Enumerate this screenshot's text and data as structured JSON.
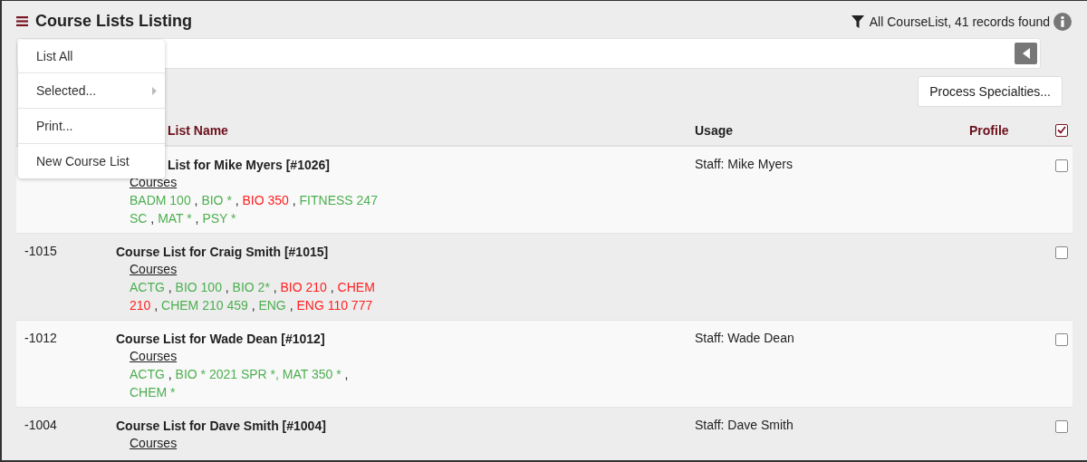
{
  "header": {
    "title": "Course Lists Listing",
    "status": "All CourseList, 41 records found"
  },
  "menu": {
    "items": [
      {
        "label": "List All",
        "submenu": false
      },
      {
        "label": "Selected...",
        "submenu": true
      },
      {
        "label": "Print...",
        "submenu": false
      },
      {
        "label": "New Course List",
        "submenu": false
      }
    ]
  },
  "toolbar": {
    "button": "Process Specialties..."
  },
  "table": {
    "columns": [
      "List Name",
      "Usage",
      "Profile"
    ],
    "select_all": {
      "checked": true
    },
    "rows": [
      {
        "id": null,
        "title": "List for Mike Myers [#1026]",
        "courses_label": "Courses",
        "usage": "Staff: Mike Myers",
        "checked": false,
        "courses": [
          {
            "text": "BADM 100",
            "color": "#4caf50",
            "sep": " ,"
          },
          {
            "text": "BIO *",
            "color": "#4caf50",
            "sep": " ,"
          },
          {
            "text": "BIO 350",
            "color": "#ff1f1f",
            "sep": " ,"
          },
          {
            "text": "FITNESS 247 SC",
            "color": "#4caf50",
            "sep": " ,"
          },
          {
            "text": "MAT *",
            "color": "#4caf50",
            "sep": " ,"
          },
          {
            "text": "PSY *",
            "color": "#4caf50"
          }
        ]
      },
      {
        "id": "-1015",
        "title": "Course List for Craig Smith [#1015]",
        "courses_label": "Courses",
        "usage": null,
        "checked": false,
        "courses": [
          {
            "text": "ACTG",
            "color": "#4caf50",
            "sep": " ,"
          },
          {
            "text": "BIO 100",
            "color": "#4caf50",
            "sep": " ,"
          },
          {
            "text": "BIO 2*",
            "color": "#4caf50",
            "sep": " ,"
          },
          {
            "text": "BIO 210",
            "color": "#ff1f1f",
            "sep": " ,"
          },
          {
            "text": "CHEM 210",
            "color": "#ff1f1f",
            "sep": " ,"
          },
          {
            "text": "CHEM 210 459",
            "color": "#4caf50",
            "sep": " ,"
          },
          {
            "text": "ENG",
            "color": "#4caf50",
            "sep": " ,"
          },
          {
            "text": "ENG 110 777",
            "color": "#ff1f1f"
          }
        ]
      },
      {
        "id": "-1012",
        "title": "Course List for Wade Dean [#1012]",
        "courses_label": "Courses",
        "usage": "Staff: Wade Dean",
        "checked": false,
        "courses": [
          {
            "text": "ACTG",
            "color": "#4caf50",
            "sep": " ,"
          },
          {
            "text": "BIO * 2021 SPR *,",
            "color": "#4caf50"
          },
          {
            "text": "MAT 350 *",
            "color": "#4caf50",
            "sep": " ,"
          },
          {
            "text": "CHEM *",
            "color": "#4caf50"
          }
        ]
      },
      {
        "id": "-1004",
        "title": "Course List for Dave Smith [#1004]",
        "courses_label": "Courses",
        "usage": "Staff: Dave Smith",
        "checked": false,
        "courses": []
      }
    ]
  }
}
